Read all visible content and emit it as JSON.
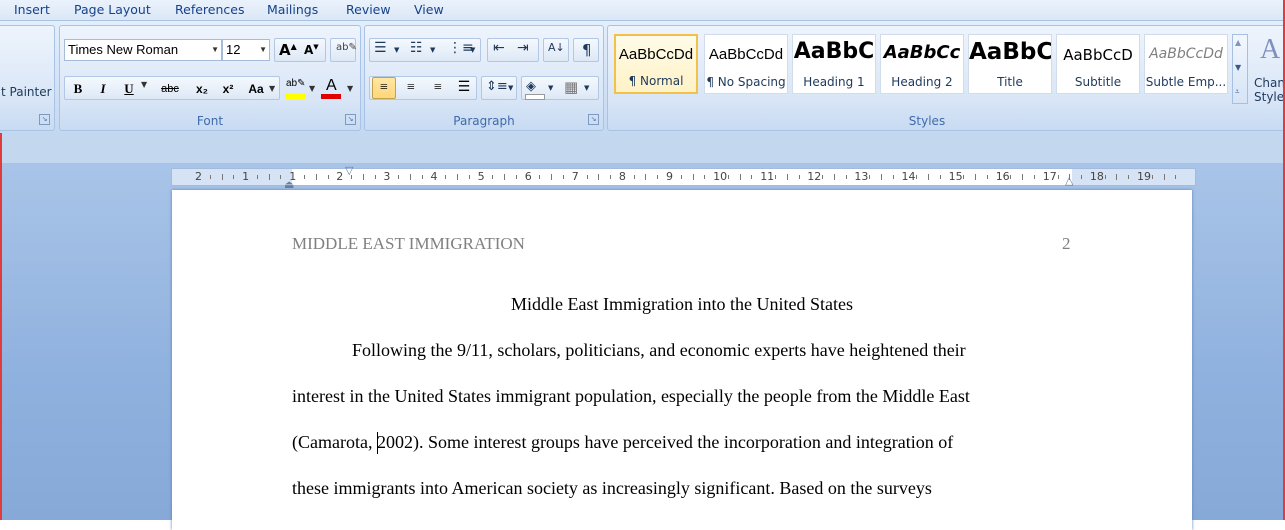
{
  "tabs": [
    "Insert",
    "Page Layout",
    "References",
    "Mailings",
    "Review",
    "View"
  ],
  "clipboard": {
    "format_painter_label": "t Painter"
  },
  "font": {
    "group_label": "Font",
    "font_name": "Times New Roman",
    "font_size": "12",
    "bold": "B",
    "italic": "I",
    "underline": "U",
    "strikethrough": "abc",
    "subscript": "x₂",
    "superscript": "x²",
    "change_case": "Aa",
    "highlight_color": "#ffff00",
    "font_color": "#e00000"
  },
  "paragraph": {
    "group_label": "Paragraph",
    "show_marks": "¶"
  },
  "styles": {
    "group_label": "Styles",
    "items": [
      {
        "preview": "AaBbCcDd",
        "name": "¶ Normal"
      },
      {
        "preview": "AaBbCcDd",
        "name": "¶ No Spacing"
      },
      {
        "preview": "AaBbC",
        "name": "Heading 1"
      },
      {
        "preview": "AaBbCc",
        "name": "Heading 2"
      },
      {
        "preview": "AaBbC",
        "name": "Title"
      },
      {
        "preview": "AaBbCcD",
        "name": "Subtitle"
      },
      {
        "preview": "AaBbCcDd",
        "name": "Subtle Emp..."
      }
    ],
    "change_styles_line1": "Chang",
    "change_styles_line2": "Styles"
  },
  "ruler": {
    "labels": [
      "2",
      "1",
      "1",
      "2",
      "3",
      "4",
      "5",
      "6",
      "7",
      "8",
      "9",
      "10",
      "11",
      "12",
      "13",
      "14",
      "15",
      "16",
      "17",
      "18",
      "19"
    ]
  },
  "document": {
    "header_left": "MIDDLE EAST IMMIGRATION",
    "header_right": "2",
    "title": "Middle East Immigration into the United States",
    "lines": [
      "Following the 9/11, scholars, politicians, and economic experts have heightened their",
      "interest in the United States immigrant population, especially the people from the Middle East",
      "(Camarota, 2002).  Some  interest groups have perceived the incorporation and integration of",
      "these immigrants into American society as increasingly significant. Based on the surveys"
    ]
  }
}
